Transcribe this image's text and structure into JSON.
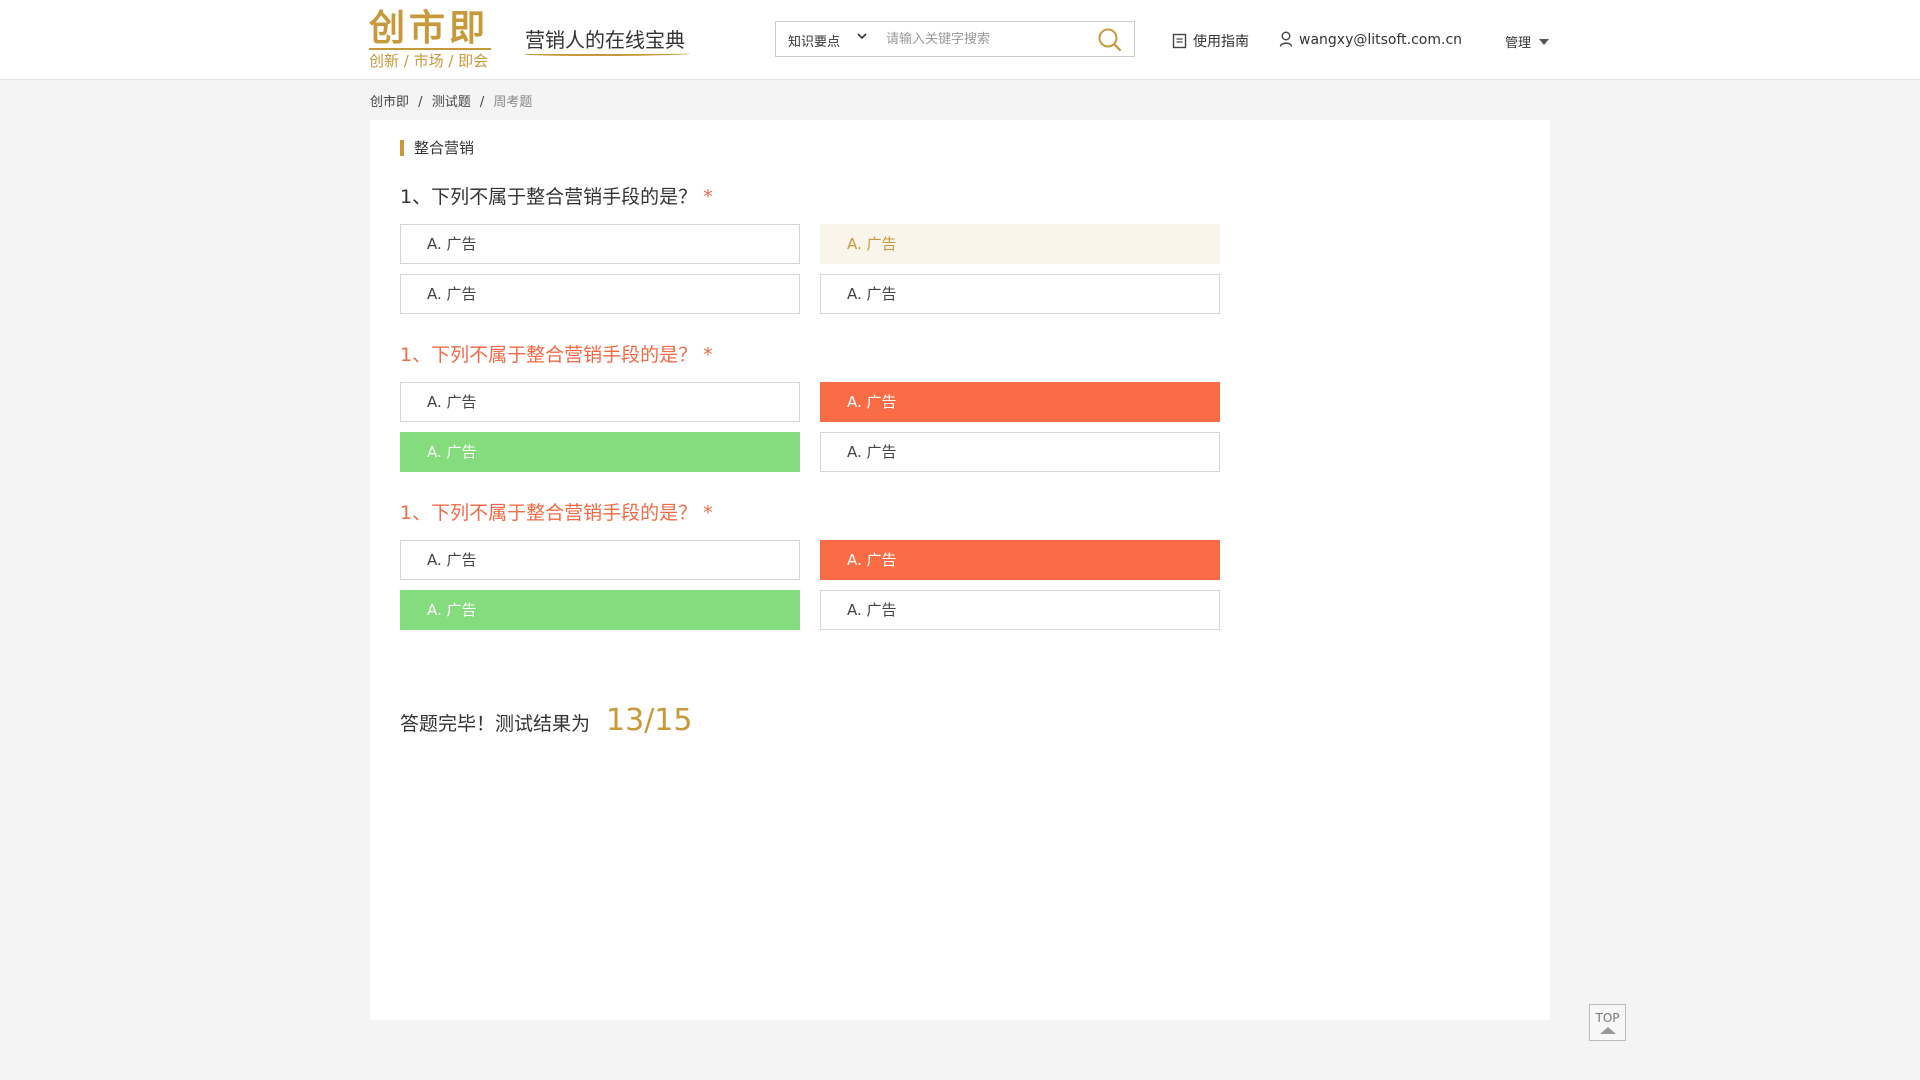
{
  "header": {
    "logo_main": "创市即",
    "logo_sub": "创新 / 市场 / 即会",
    "slogan": "营销人的在线宝典",
    "search": {
      "category": "知识要点",
      "placeholder": "请输入关键字搜索",
      "value": ""
    },
    "guide_label": "使用指南",
    "user_email": "wangxy@litsoft.com.cn",
    "manage_label": "管理"
  },
  "breadcrumb": {
    "items": [
      "创市即",
      "测试题"
    ],
    "current": "周考题",
    "separator": "/"
  },
  "section": {
    "title": "整合营销"
  },
  "questions": [
    {
      "text": "1、下列不属于整合营销手段的是？",
      "required_mark": "*",
      "status": "unanswered",
      "options": [
        {
          "label": "A. 广告",
          "state": "normal"
        },
        {
          "label": "A. 广告",
          "state": "selected"
        },
        {
          "label": "A. 广告",
          "state": "normal"
        },
        {
          "label": "A. 广告",
          "state": "normal"
        }
      ]
    },
    {
      "text": "1、下列不属于整合营销手段的是？",
      "required_mark": "*",
      "status": "wrong",
      "options": [
        {
          "label": "A. 广告",
          "state": "normal"
        },
        {
          "label": "A. 广告",
          "state": "wrong"
        },
        {
          "label": "A. 广告",
          "state": "correct"
        },
        {
          "label": "A. 广告",
          "state": "normal"
        }
      ]
    },
    {
      "text": "1、下列不属于整合营销手段的是？",
      "required_mark": "*",
      "status": "wrong",
      "options": [
        {
          "label": "A. 广告",
          "state": "normal"
        },
        {
          "label": "A. 广告",
          "state": "wrong"
        },
        {
          "label": "A. 广告",
          "state": "correct"
        },
        {
          "label": "A. 广告",
          "state": "normal"
        }
      ]
    }
  ],
  "result": {
    "text": "答题完毕！测试结果为",
    "score": "13/15"
  },
  "top_button": {
    "label": "TOP"
  },
  "colors": {
    "brand_gold": "#c8993a",
    "wrong": "#fa6c46",
    "correct": "#84dc7c",
    "selected_bg": "#faf5ea"
  },
  "icons": {
    "search": "search-icon",
    "guide": "document-icon",
    "user": "user-icon",
    "dropdown": "chevron-down-icon",
    "top": "arrow-up-icon"
  }
}
